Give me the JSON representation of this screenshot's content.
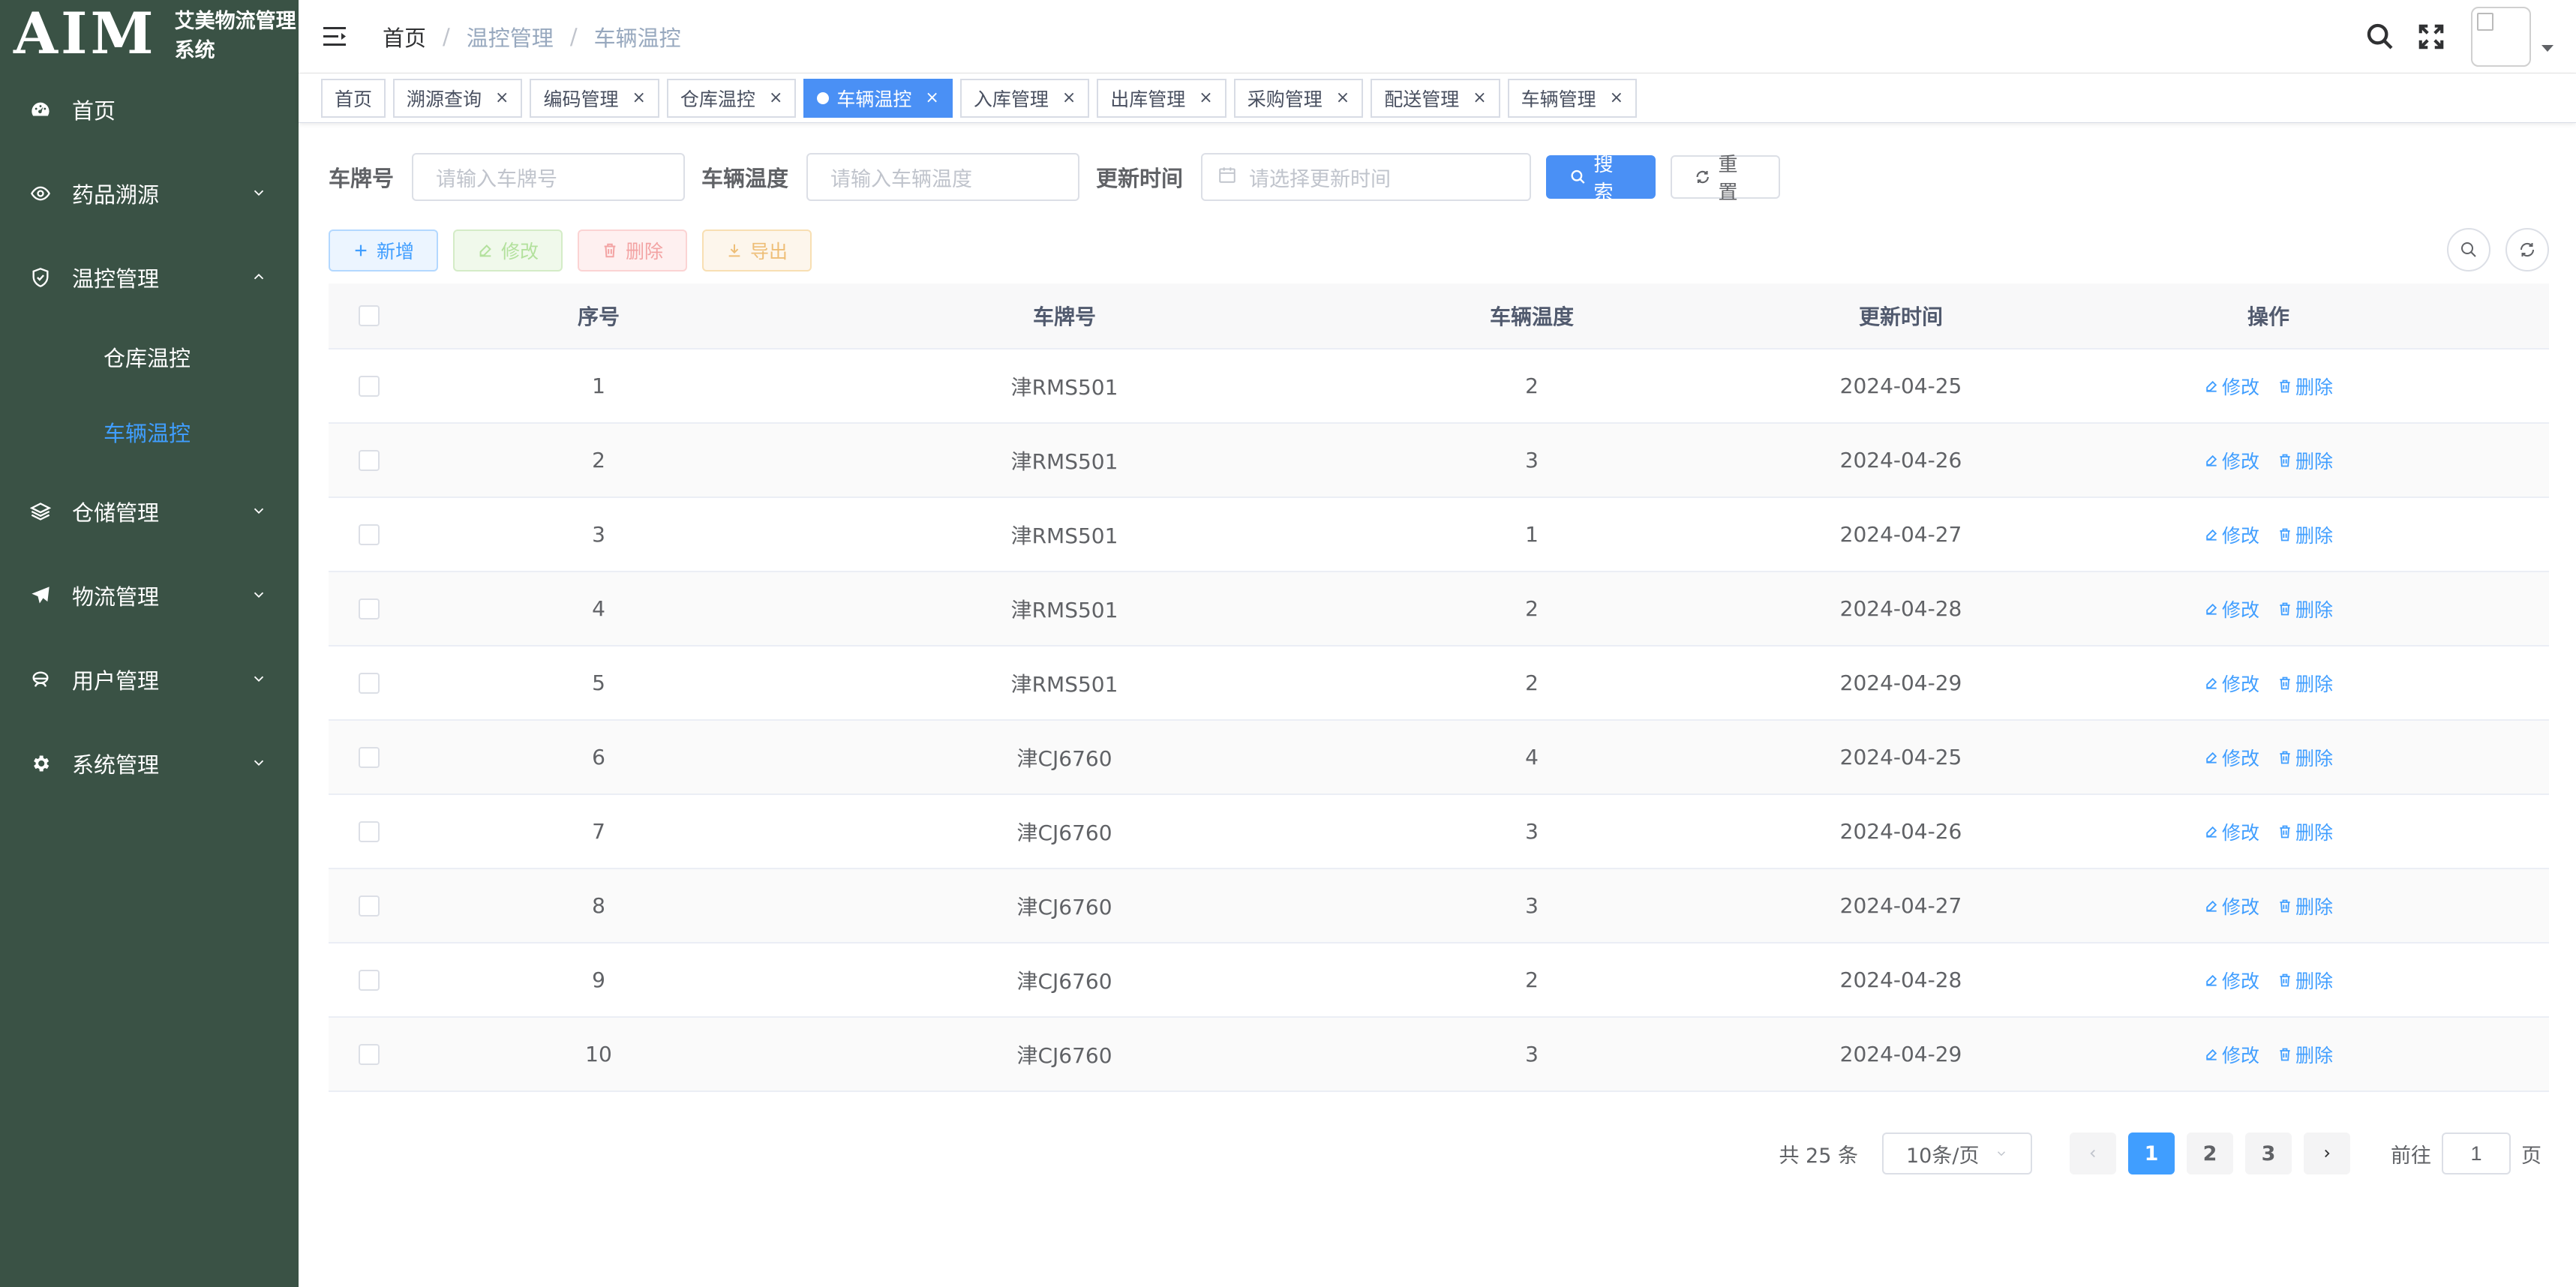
{
  "app": {
    "logo_text": "AIM",
    "title": "艾美物流管理系统"
  },
  "sidebar": {
    "items": [
      {
        "label": "首页",
        "icon": "dashboard-icon"
      },
      {
        "label": "药品溯源",
        "icon": "eye-icon"
      },
      {
        "label": "温控管理",
        "icon": "shield-icon",
        "expanded": true,
        "children": [
          {
            "label": "仓库温控",
            "active": false
          },
          {
            "label": "车辆温控",
            "active": true
          }
        ]
      },
      {
        "label": "仓储管理",
        "icon": "layers-icon"
      },
      {
        "label": "物流管理",
        "icon": "send-icon"
      },
      {
        "label": "用户管理",
        "icon": "peoples-icon"
      },
      {
        "label": "系统管理",
        "icon": "gear-icon"
      }
    ]
  },
  "breadcrumb": [
    "首页",
    "温控管理",
    "车辆温控"
  ],
  "tags": [
    {
      "label": "首页",
      "closable": false
    },
    {
      "label": "溯源查询",
      "closable": true
    },
    {
      "label": "编码管理",
      "closable": true
    },
    {
      "label": "仓库温控",
      "closable": true
    },
    {
      "label": "车辆温控",
      "closable": true,
      "active": true
    },
    {
      "label": "入库管理",
      "closable": true
    },
    {
      "label": "出库管理",
      "closable": true
    },
    {
      "label": "采购管理",
      "closable": true
    },
    {
      "label": "配送管理",
      "closable": true
    },
    {
      "label": "车辆管理",
      "closable": true
    }
  ],
  "search": {
    "plate_label": "车牌号",
    "plate_placeholder": "请输入车牌号",
    "temp_label": "车辆温度",
    "temp_placeholder": "请输入车辆温度",
    "time_label": "更新时间",
    "time_placeholder": "请选择更新时间",
    "search_btn": "搜索",
    "reset_btn": "重置"
  },
  "toolbar": {
    "add": "新增",
    "edit": "修改",
    "delete": "删除",
    "export": "导出"
  },
  "table": {
    "headers": {
      "index": "序号",
      "plate": "车牌号",
      "temp": "车辆温度",
      "time": "更新时间",
      "ops": "操作"
    },
    "edit_label": "修改",
    "delete_label": "删除",
    "rows": [
      {
        "index": "1",
        "plate": "津RMS501",
        "temp": "2",
        "time": "2024-04-25"
      },
      {
        "index": "2",
        "plate": "津RMS501",
        "temp": "3",
        "time": "2024-04-26"
      },
      {
        "index": "3",
        "plate": "津RMS501",
        "temp": "1",
        "time": "2024-04-27"
      },
      {
        "index": "4",
        "plate": "津RMS501",
        "temp": "2",
        "time": "2024-04-28"
      },
      {
        "index": "5",
        "plate": "津RMS501",
        "temp": "2",
        "time": "2024-04-29"
      },
      {
        "index": "6",
        "plate": "津CJ6760",
        "temp": "4",
        "time": "2024-04-25"
      },
      {
        "index": "7",
        "plate": "津CJ6760",
        "temp": "3",
        "time": "2024-04-26"
      },
      {
        "index": "8",
        "plate": "津CJ6760",
        "temp": "3",
        "time": "2024-04-27"
      },
      {
        "index": "9",
        "plate": "津CJ6760",
        "temp": "2",
        "time": "2024-04-28"
      },
      {
        "index": "10",
        "plate": "津CJ6760",
        "temp": "3",
        "time": "2024-04-29"
      }
    ]
  },
  "pagination": {
    "total": "共 25 条",
    "page_size": "10条/页",
    "pages": [
      "1",
      "2",
      "3"
    ],
    "current": "1",
    "goto_label": "前往",
    "goto_value": "1",
    "page_unit": "页"
  },
  "colors": {
    "sidebar_bg": "#3a5245",
    "primary": "#409eff",
    "active_tag": "#4a90f5"
  }
}
